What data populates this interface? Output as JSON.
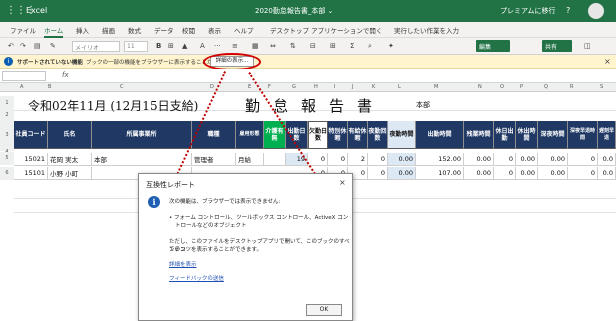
{
  "titlebar": {
    "app": "Excel",
    "doc_title": "2020勤怠報告書_本部 ⌄",
    "premium": "プレミアムに移行",
    "help": "?"
  },
  "menu": {
    "items": [
      "ファイル",
      "ホーム",
      "挿入",
      "描画",
      "数式",
      "データ",
      "校閲",
      "表示",
      "ヘルプ",
      "デスクトップ アプリケーションで開く"
    ],
    "search": "実行したい作業を入力"
  },
  "ribbon": {
    "font_placeholder": "メイリオ",
    "size_value": "11",
    "edit_label": "編集",
    "share_label": "共有"
  },
  "infobar": {
    "title": "サポートされていない機能",
    "message": "ブックの一部の機能をブラウザーに表示することができません。",
    "detail_button": "詳細の表示...",
    "close": "×"
  },
  "formula": {
    "namebox": "",
    "fx": "fx"
  },
  "columns": [
    "A",
    "B",
    "C",
    "D",
    "E",
    "F",
    "G",
    "H",
    "I",
    "J",
    "K",
    "L",
    "M",
    "N",
    "O",
    "P",
    "Q",
    "R",
    "S",
    "T",
    "U"
  ],
  "rows": [
    "1",
    "2",
    "3",
    "4",
    "5",
    "6"
  ],
  "sheet": {
    "date_title": "令和02年11月 (12月15日支給)",
    "report_title": "勤怠報告書",
    "dept": "本部",
    "headers": [
      "社員コード",
      "氏名",
      "所属事業所",
      "職種",
      "雇用形態",
      "介護有無",
      "出勤日数",
      "欠勤日数",
      "特別休暇",
      "有給休暇",
      "夜勤回数",
      "夜勤時間",
      "出勤時間",
      "残業時間",
      "休日出勤",
      "休出時間",
      "深夜時間",
      "深夜早退時間",
      "遅刻早退"
    ],
    "records": [
      {
        "code": "15021",
        "name": "花岡 実太",
        "office": "本部",
        "job": "管理者",
        "type": "月給",
        "attend": "19",
        "absent": "0",
        "special": "0",
        "paid": "2",
        "night_cnt": "0",
        "night_time": "0.00",
        "work": "152.00",
        "overtime": "0.00",
        "holiday": "0",
        "holiday_time": "0.00",
        "late_night": "0.00",
        "early": "0",
        "late": "0.0"
      },
      {
        "code": "15101",
        "name": "小野 小町",
        "office": "",
        "job": "",
        "type": "",
        "attend": "",
        "absent": "0",
        "special": "0",
        "paid": "0",
        "night_cnt": "0",
        "night_time": "0.00",
        "work": "107.00",
        "overtime": "0.00",
        "holiday": "0",
        "holiday_time": "0.00",
        "late_night": "0.00",
        "early": "0",
        "late": "0.0"
      }
    ]
  },
  "dialog": {
    "title": "互換性レポート",
    "line1": "次の機能は、ブラウザーでは表示できません:",
    "line2": "• フォーム コントロール、ツールボックス コントロール、ActiveX コン",
    "line3": "トロールなどのオブジェクト",
    "line4": "ただし、このファイルをデスクトップアプリで開いて、このブックのすべてのコ",
    "line5": "ンテンツを表示することができます。",
    "link1": "詳細を表示",
    "link2": "フィードバックの送信",
    "ok": "OK",
    "close": "×"
  },
  "colors": {
    "excel_green": "#217346",
    "header_navy": "#1f3864",
    "header_green": "#00b050",
    "annotation_red": "#d00000",
    "info_bar": "#fff4ce"
  }
}
